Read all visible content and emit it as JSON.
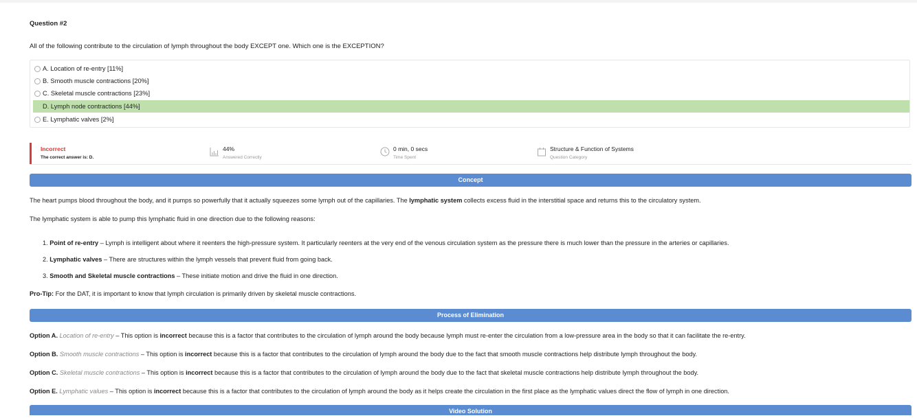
{
  "question": {
    "number": "Question #2",
    "text": "All of the following contribute to the circulation of lymph throughout the body EXCEPT one. Which one is the EXCEPTION?"
  },
  "options": [
    {
      "label": "A. Location of re-entry [11%]",
      "selected": false
    },
    {
      "label": "B. Smooth muscle contractions [20%]",
      "selected": false
    },
    {
      "label": "C. Skeletal muscle contractions [23%]",
      "selected": false
    },
    {
      "label": "D. Lymph node contractions [44%]",
      "selected": true
    },
    {
      "label": "E. Lymphatic valves [2%]",
      "selected": false
    }
  ],
  "stats": {
    "result": "Incorrect",
    "correct_answer": "The correct answer is: D.",
    "percent": "44%",
    "percent_label": "Answered Correctly",
    "time": "0 min, 0 secs",
    "time_label": "Time Spent",
    "category": "Structure & Function of Systems",
    "category_label": "Question Category"
  },
  "sections": {
    "concept": "Concept",
    "elimination": "Process of Elimination",
    "video": "Video Solution"
  },
  "concept": {
    "p1_a": "The heart pumps blood throughout the body, and it pumps so powerfully that it actually squeezes some lymph out of the capillaries. The ",
    "p1_b": "lymphatic system",
    "p1_c": " collects excess fluid in the interstitial space and returns this to the circulatory system.",
    "p2": "The lymphatic system is able to pump this lymphatic fluid in one direction due to the following reasons:",
    "items": [
      {
        "num": "1. ",
        "bold": "Point of re-entry",
        "text": " – Lymph is intelligent about where it reenters the high-pressure system. It particularly reenters at the very end of the venous circulation system as the pressure there is much lower than the pressure in the arteries or capillaries."
      },
      {
        "num": "2. ",
        "bold": "Lymphatic valves",
        "text": " – There are structures within the lymph vessels that prevent fluid from going back."
      },
      {
        "num": "3. ",
        "bold": "Smooth and Skeletal muscle contractions",
        "text": " – These initiate motion and drive the fluid in one direction."
      }
    ],
    "protip_label": "Pro-Tip:",
    "protip_text": " For the DAT, it is important to know that lymph circulation is primarily driven by skeletal muscle contractions."
  },
  "elimination": [
    {
      "opt": "Option A.",
      "name": "Location of re-entry",
      "pre": " – This option is ",
      "verdict": "incorrect",
      "text": " because this is a factor that contributes to the circulation of lymph around the body because lymph must re-enter the circulation from a low-pressure area in the body so that it can facilitate the re-entry."
    },
    {
      "opt": "Option B.",
      "name": "Smooth muscle contractions",
      "pre": " – This option is ",
      "verdict": "incorrect",
      "text": " because this is a factor that contributes to the circulation of lymph around the body due to the fact that smooth muscle contractions help distribute lymph throughout the body."
    },
    {
      "opt": "Option C.",
      "name": "Skeletal muscle contractions",
      "pre": " – This option is ",
      "verdict": "incorrect",
      "text": " because this is a factor that contributes to the circulation of lymph around the body due to the fact that skeletal muscle contractions help distribute lymph throughout the body."
    },
    {
      "opt": "Option E.",
      "name": "Lymphatic values",
      "pre": " – This option is ",
      "verdict": "incorrect",
      "text": " because this is a factor that contributes to the circulation of lymph around the body as it helps create the circulation in the first place as the lymphatic values direct the flow of lymph in one direction."
    }
  ],
  "colors": {
    "accent": "#5b8bd0",
    "selected": "#bfe0ad",
    "error": "#d63b3b"
  },
  "icons": [
    "bar-chart-icon",
    "clock-icon",
    "calendar-icon",
    "radio-icon"
  ]
}
